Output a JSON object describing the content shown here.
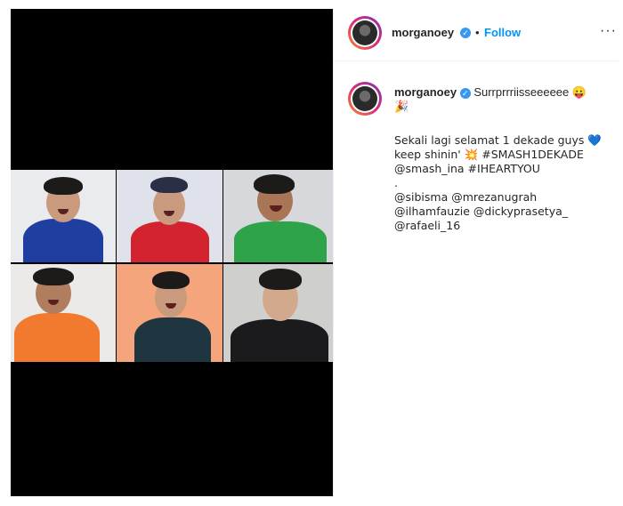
{
  "post": {
    "author": "morganoey",
    "follow_label": "Follow",
    "separator": "•",
    "more_label": "···",
    "caption_start": "Surrprrriisseeeeee 😛",
    "caption_emoji_2": "🎉",
    "line1": "Sekali lagi selamat 1 dekade guys 💙",
    "line2_a": "keep shinin' 💥 #SMASH1DEKADE",
    "line3": "@smash_ina #IHEARTYOU",
    "line4": ".",
    "line5": "@sibisma @mrezanugrah",
    "line6": "@ilhamfauzie @dickyprasetya_",
    "line7": "@rafaeli_16"
  },
  "colors": {
    "accent": "#0095f6",
    "verified": "#3897f0",
    "media_bg": "#000000"
  },
  "icons": {
    "verified": "verified-badge-icon",
    "more": "more-options-icon"
  }
}
